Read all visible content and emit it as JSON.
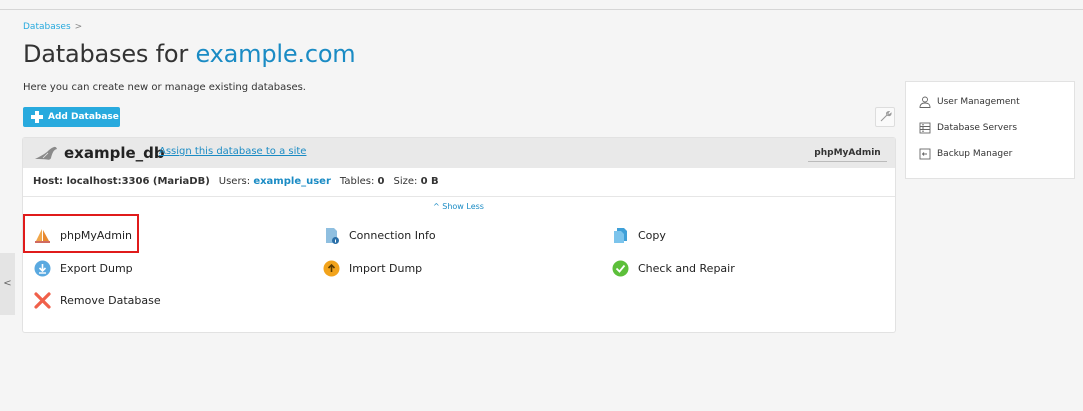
{
  "breadcrumb": {
    "item": "Databases",
    "separator": ">"
  },
  "page": {
    "title_prefix": "Databases for",
    "title_domain": "example.com",
    "subtitle": "Here you can create new or manage existing databases."
  },
  "toolbar": {
    "add_label": "Add Database"
  },
  "database": {
    "name": "example_db",
    "assign_link": "Assign this database to a site",
    "pma_button": "phpMyAdmin",
    "host_label": "Host: localhost:3306 (MariaDB)",
    "users_label": "Users:",
    "user": "example_user",
    "tables_label": "Tables:",
    "tables": "0",
    "size_label": "Size:",
    "size": "0 B",
    "show_less": "^ Show Less",
    "actions": {
      "phpmyadmin": "phpMyAdmin",
      "connection_info": "Connection Info",
      "copy": "Copy",
      "export_dump": "Export Dump",
      "import_dump": "Import Dump",
      "check_repair": "Check and Repair",
      "remove": "Remove Database"
    }
  },
  "sidebar": {
    "items": [
      {
        "label": "User Management",
        "icon": "user-icon"
      },
      {
        "label": "Database Servers",
        "icon": "server-icon"
      },
      {
        "label": "Backup Manager",
        "icon": "backup-icon"
      }
    ]
  },
  "collapse": {
    "label": "<"
  },
  "colors": {
    "accent": "#28aade",
    "link": "#1a8bc4",
    "highlight": "#e01b1b"
  }
}
